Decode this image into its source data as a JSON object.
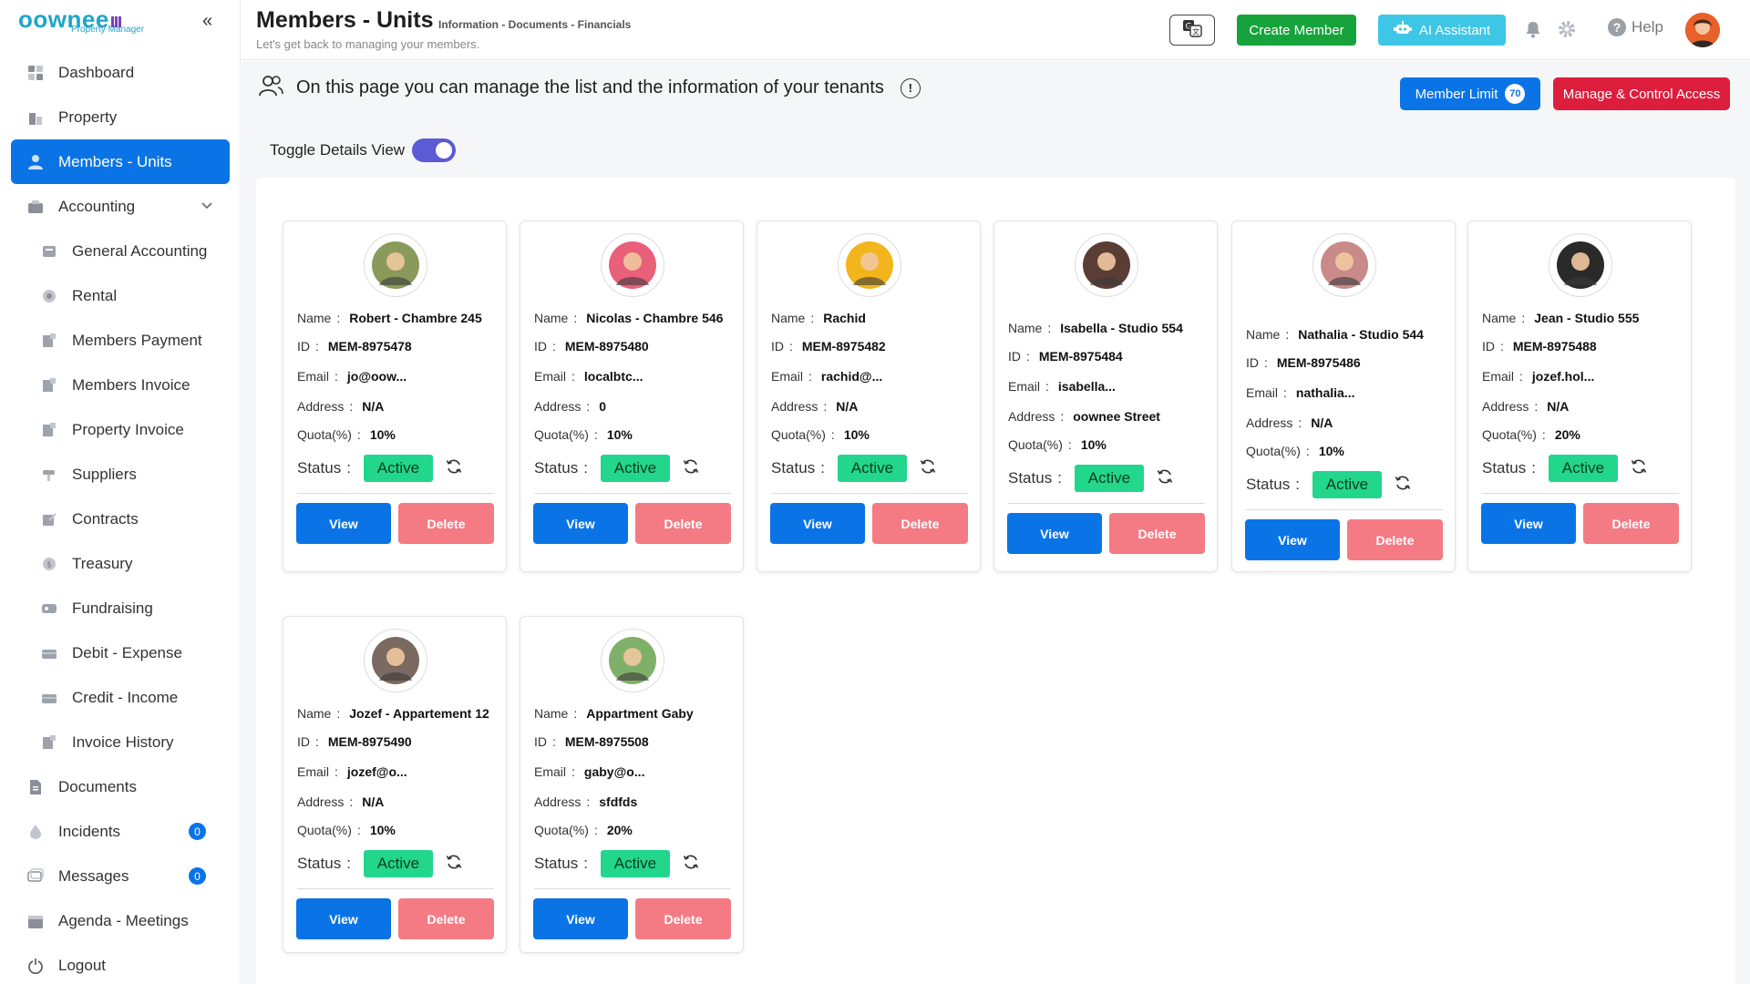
{
  "brand": {
    "logo": "oownee",
    "tagline": "Property Manager"
  },
  "sidebar": {
    "items": [
      {
        "label": "Dashboard",
        "icon": "dashboard-icon"
      },
      {
        "label": "Property",
        "icon": "property-icon"
      },
      {
        "label": "Members - Units",
        "icon": "members-icon",
        "active": true
      },
      {
        "label": "Accounting",
        "icon": "accounting-icon"
      },
      {
        "label": "General Accounting",
        "icon": "general-accounting-icon"
      },
      {
        "label": "Rental",
        "icon": "rental-icon"
      },
      {
        "label": "Members Payment",
        "icon": "members-payment-icon"
      },
      {
        "label": "Members Invoice",
        "icon": "members-invoice-icon"
      },
      {
        "label": "Property Invoice",
        "icon": "property-invoice-icon"
      },
      {
        "label": "Suppliers",
        "icon": "suppliers-icon"
      },
      {
        "label": "Contracts",
        "icon": "contracts-icon"
      },
      {
        "label": "Treasury",
        "icon": "treasury-icon"
      },
      {
        "label": "Fundraising",
        "icon": "fundraising-icon"
      },
      {
        "label": "Debit - Expense",
        "icon": "debit-expense-icon"
      },
      {
        "label": "Credit - Income",
        "icon": "credit-income-icon"
      },
      {
        "label": "Invoice History",
        "icon": "invoice-history-icon"
      },
      {
        "label": "Documents",
        "icon": "documents-icon"
      },
      {
        "label": "Incidents",
        "icon": "incidents-icon",
        "badge": "0"
      },
      {
        "label": "Messages",
        "icon": "messages-icon",
        "badge": "0"
      },
      {
        "label": "Agenda - Meetings",
        "icon": "agenda-icon"
      },
      {
        "label": "Logout",
        "icon": "logout-icon"
      }
    ]
  },
  "header": {
    "title": "Members - Units",
    "crumbs": "Information - Documents - Financials",
    "subtitle": "Let's get back to managing your members.",
    "create_label": "Create Member",
    "ai_label": "AI Assistant",
    "help_label": "Help"
  },
  "main": {
    "info_text": "On this page you can manage the list and the information of your tenants",
    "member_limit_label": "Member Limit",
    "member_limit_count": "70",
    "access_label": "Manage & Control Access",
    "toggle_label": "Toggle Details View"
  },
  "labels": {
    "name": "Name",
    "id": "ID",
    "email": "Email",
    "address": "Address",
    "quota": "Quota(%)",
    "status": "Status",
    "view": "View",
    "delete": "Delete"
  },
  "members": [
    {
      "name": "Robert - Chambre 245",
      "id": "MEM-8975478",
      "email": "jo@oow...",
      "address": "N/A",
      "quota": "10%",
      "status": "Active",
      "avatar_color": "#8a9a5b"
    },
    {
      "name": "Nicolas - Chambre 546",
      "id": "MEM-8975480",
      "email": "localbtc...",
      "address": "0",
      "quota": "10%",
      "status": "Active",
      "avatar_color": "#e8607a"
    },
    {
      "name": "Rachid",
      "id": "MEM-8975482",
      "email": "rachid@...",
      "address": "N/A",
      "quota": "10%",
      "status": "Active",
      "avatar_color": "#f2b51c"
    },
    {
      "name": "Isabella - Studio 554",
      "id": "MEM-8975484",
      "email": "isabella...",
      "address": "oownee Street",
      "quota": "10%",
      "status": "Active",
      "avatar_color": "#5a3e36"
    },
    {
      "name": "Nathalia - Studio 544",
      "id": "MEM-8975486",
      "email": "nathalia...",
      "address": "N/A",
      "quota": "10%",
      "status": "Active",
      "avatar_color": "#c98a8a"
    },
    {
      "name": "Jean - Studio 555",
      "id": "MEM-8975488",
      "email": "jozef.hol...",
      "address": "N/A",
      "quota": "20%",
      "status": "Active",
      "avatar_color": "#2a2a2a"
    },
    {
      "name": "Jozef - Appartement 12",
      "id": "MEM-8975490",
      "email": "jozef@o...",
      "address": "N/A",
      "quota": "10%",
      "status": "Active",
      "avatar_color": "#7a6a60"
    },
    {
      "name": "Appartment Gaby",
      "id": "MEM-8975508",
      "email": "gaby@o...",
      "address": "sfdfds",
      "quota": "20%",
      "status": "Active",
      "avatar_color": "#7fb069"
    }
  ]
}
